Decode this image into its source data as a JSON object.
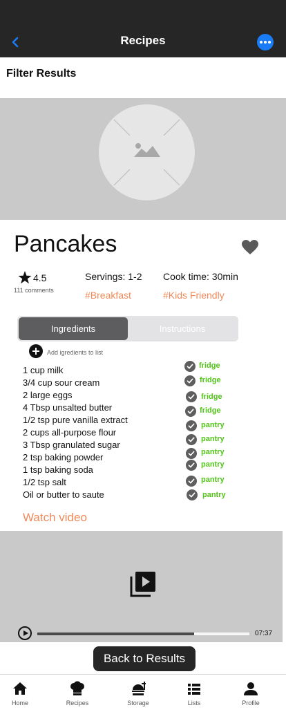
{
  "nav": {
    "title": "Recipes"
  },
  "filter_results": "Filter Results",
  "recipe": {
    "title": "Pancakes",
    "rating": "4.5",
    "comments": "111 comments",
    "servings": "Servings: 1-2",
    "cook_time": "Cook time: 30min",
    "tags": [
      "#Breakfast",
      "#Kids Friendly"
    ]
  },
  "segments": {
    "ingredients": "Ingredients",
    "instructions": "Instructions"
  },
  "add_to_list": "Add igredients to list",
  "ingredients": [
    {
      "name": "1 cup milk",
      "storage": "fridge"
    },
    {
      "name": "3/4 cup sour cream",
      "storage": "fridge"
    },
    {
      "name": "2 large eggs",
      "storage": "fridge"
    },
    {
      "name": "4 Tbsp unsalted butter",
      "storage": "fridge"
    },
    {
      "name": "1/2 tsp pure vanilla extract",
      "storage": "pantry"
    },
    {
      "name": "2 cups all-purpose flour",
      "storage": "pantry"
    },
    {
      "name": "3 Tbsp granulated sugar",
      "storage": "pantry"
    },
    {
      "name": "2 tsp baking powder",
      "storage": "pantry"
    },
    {
      "name": "1 tsp baking soda",
      "storage": "pantry"
    },
    {
      "name": "1/2 tsp salt",
      "storage": "pantry"
    },
    {
      "name": "Oil or butter to saute",
      "storage": "pantry"
    }
  ],
  "watch_video": "Watch video",
  "video": {
    "duration": "07:37",
    "progress": 0.74
  },
  "back_button": "Back to Results",
  "tabs": [
    {
      "label": "Home",
      "icon": "home-icon"
    },
    {
      "label": "Recipes",
      "icon": "chef-hat-icon"
    },
    {
      "label": "Storage",
      "icon": "storage-icon"
    },
    {
      "label": "Lists",
      "icon": "list-icon"
    },
    {
      "label": "Profile",
      "icon": "profile-icon"
    }
  ],
  "colors": {
    "navbar": "#262626",
    "accent_blue": "#1a7cf5",
    "tag_orange": "#ef8a5a",
    "storage_green": "#52c41a"
  }
}
